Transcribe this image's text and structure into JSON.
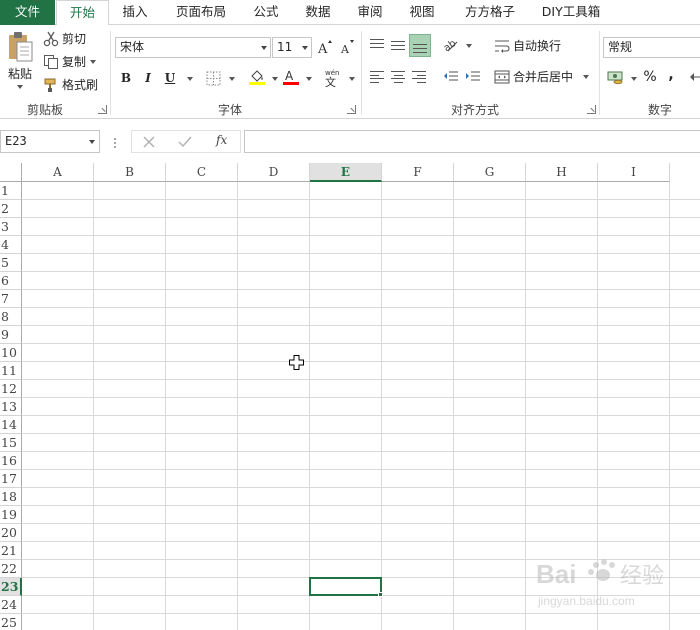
{
  "tabs": [
    "文件",
    "开始",
    "插入",
    "页面布局",
    "公式",
    "数据",
    "审阅",
    "视图",
    "方方格子",
    "DIY工具箱"
  ],
  "clipboard": {
    "paste": "粘贴",
    "cut": "剪切",
    "copy": "复制",
    "format_painter": "格式刷",
    "group": "剪贴板"
  },
  "font": {
    "name": "宋体",
    "size": "11",
    "bold": "B",
    "italic": "I",
    "underline": "U",
    "group": "字体",
    "text_color": "#ff0000",
    "fill_color": "#ffff00"
  },
  "alignment": {
    "wrap_text": "自动换行",
    "merge_center": "合并后居中",
    "group": "对齐方式"
  },
  "number": {
    "format": "常规",
    "percent": "%",
    "comma": ",",
    "group": "数字"
  },
  "formula_bar": {
    "name_box": "E23",
    "fx": "fx",
    "value": ""
  },
  "sheet": {
    "columns": [
      "A",
      "B",
      "C",
      "D",
      "E",
      "F",
      "G",
      "H",
      "I"
    ],
    "rows": [
      "1",
      "2",
      "3",
      "4",
      "5",
      "6",
      "7",
      "8",
      "9",
      "10",
      "11",
      "12",
      "13",
      "14",
      "15",
      "16",
      "17",
      "18",
      "19",
      "20",
      "21",
      "22",
      "23",
      "24",
      "25"
    ],
    "selected_column": "E",
    "selected_row": "23",
    "accent": "#217346"
  },
  "watermark": {
    "brand": "Bai",
    "brand2": "经验",
    "url": "jingyan.baidu.com"
  }
}
